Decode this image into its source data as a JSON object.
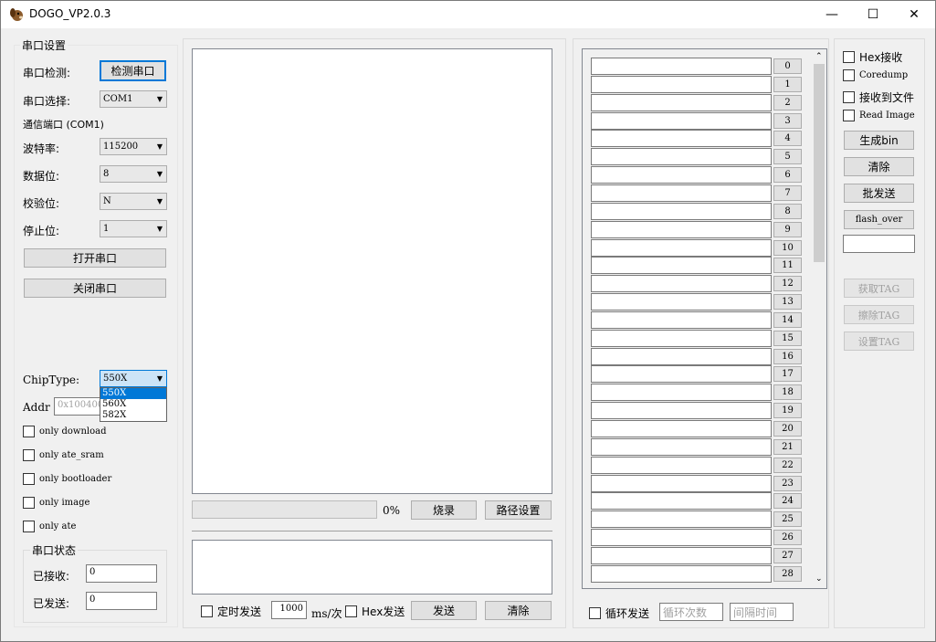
{
  "window": {
    "title": "DOGO_VP2.0.3",
    "minimize": "—",
    "maximize": "☐",
    "close": "✕"
  },
  "serial_settings": {
    "group_title": "串口设置",
    "detect_label": "串口检测:",
    "detect_button": "检测串口",
    "select_label": "串口选择:",
    "select_value": "COM1",
    "port_info": "通信端口 (COM1)",
    "baud_label": "波特率:",
    "baud_value": "115200",
    "databits_label": "数据位:",
    "databits_value": "8",
    "parity_label": "校验位:",
    "parity_value": "N",
    "stopbits_label": "停止位:",
    "stopbits_value": "1",
    "open_button": "打开串口",
    "close_button": "关闭串口"
  },
  "chip": {
    "label": "ChipType:",
    "value": "550X",
    "options": [
      "550X",
      "560X",
      "582X"
    ],
    "addr_label": "Addr",
    "addr_value": "0x100400"
  },
  "options": [
    "only download",
    "only ate_sram",
    "only bootloader",
    "only image",
    "only ate"
  ],
  "serial_status": {
    "group_title": "串口状态",
    "received_label": "已接收:",
    "received_value": "0",
    "sent_label": "已发送:",
    "sent_value": "0"
  },
  "center": {
    "progress_percent": "0%",
    "progress_value": 0,
    "burn_button": "烧录",
    "path_button": "路径设置",
    "timed_send": "定时发送",
    "interval_value": "1000",
    "interval_unit": "ms/次",
    "hex_send": "Hex发送",
    "send_button": "发送",
    "clear_button": "清除"
  },
  "batch": {
    "row_labels": [
      "0",
      "1",
      "2",
      "3",
      "4",
      "5",
      "6",
      "7",
      "8",
      "9",
      "10",
      "11",
      "12",
      "13",
      "14",
      "15",
      "16",
      "17",
      "18",
      "19",
      "20",
      "21",
      "22",
      "23",
      "24",
      "25",
      "26",
      "27",
      "28"
    ],
    "loop_send": "循环发送",
    "loop_count_placeholder": "循环次数",
    "interval_placeholder": "间隔时间"
  },
  "right": {
    "hex_receive": "Hex接收",
    "coredump": "Coredump",
    "receive_to_file": "接收到文件",
    "read_image": "Read Image",
    "gen_bin": "生成bin",
    "clear": "清除",
    "batch_send": "批发送",
    "flash_over": "flash_over",
    "flash_input": "",
    "get_tag": "获取TAG",
    "erase_tag": "擦除TAG",
    "set_tag": "设置TAG"
  }
}
